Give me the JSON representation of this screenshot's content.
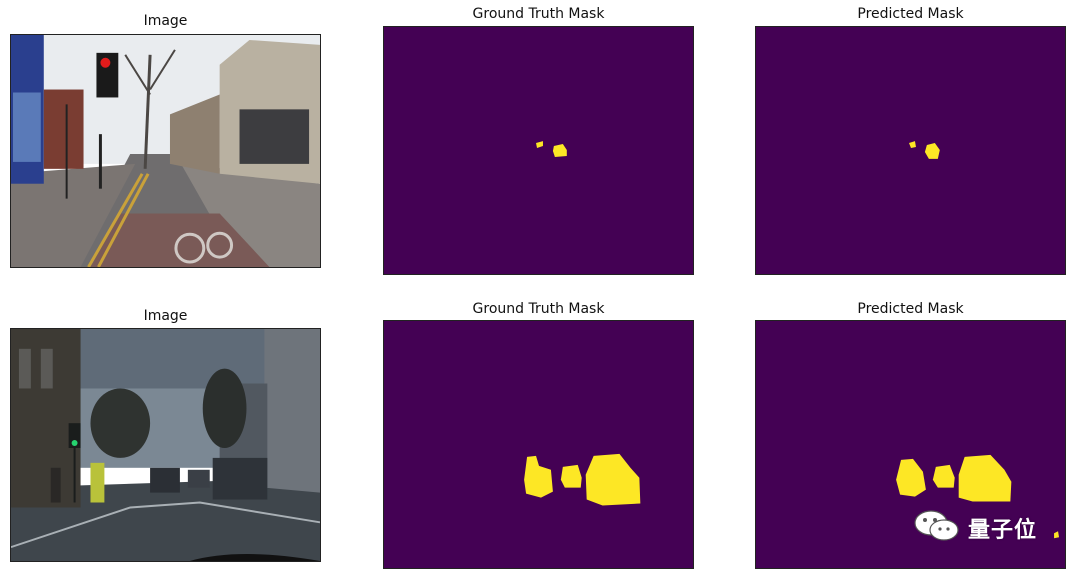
{
  "rows": [
    {
      "image_title": "Image",
      "gt_title": "Ground Truth Mask",
      "pred_title": "Predicted Mask"
    },
    {
      "image_title": "Image",
      "gt_title": "Ground Truth Mask",
      "pred_title": "Predicted Mask"
    }
  ],
  "colors": {
    "mask_background": "#440154",
    "mask_foreground": "#fde725"
  },
  "watermark": {
    "icon": "wechat-icon",
    "text": "量子位"
  }
}
